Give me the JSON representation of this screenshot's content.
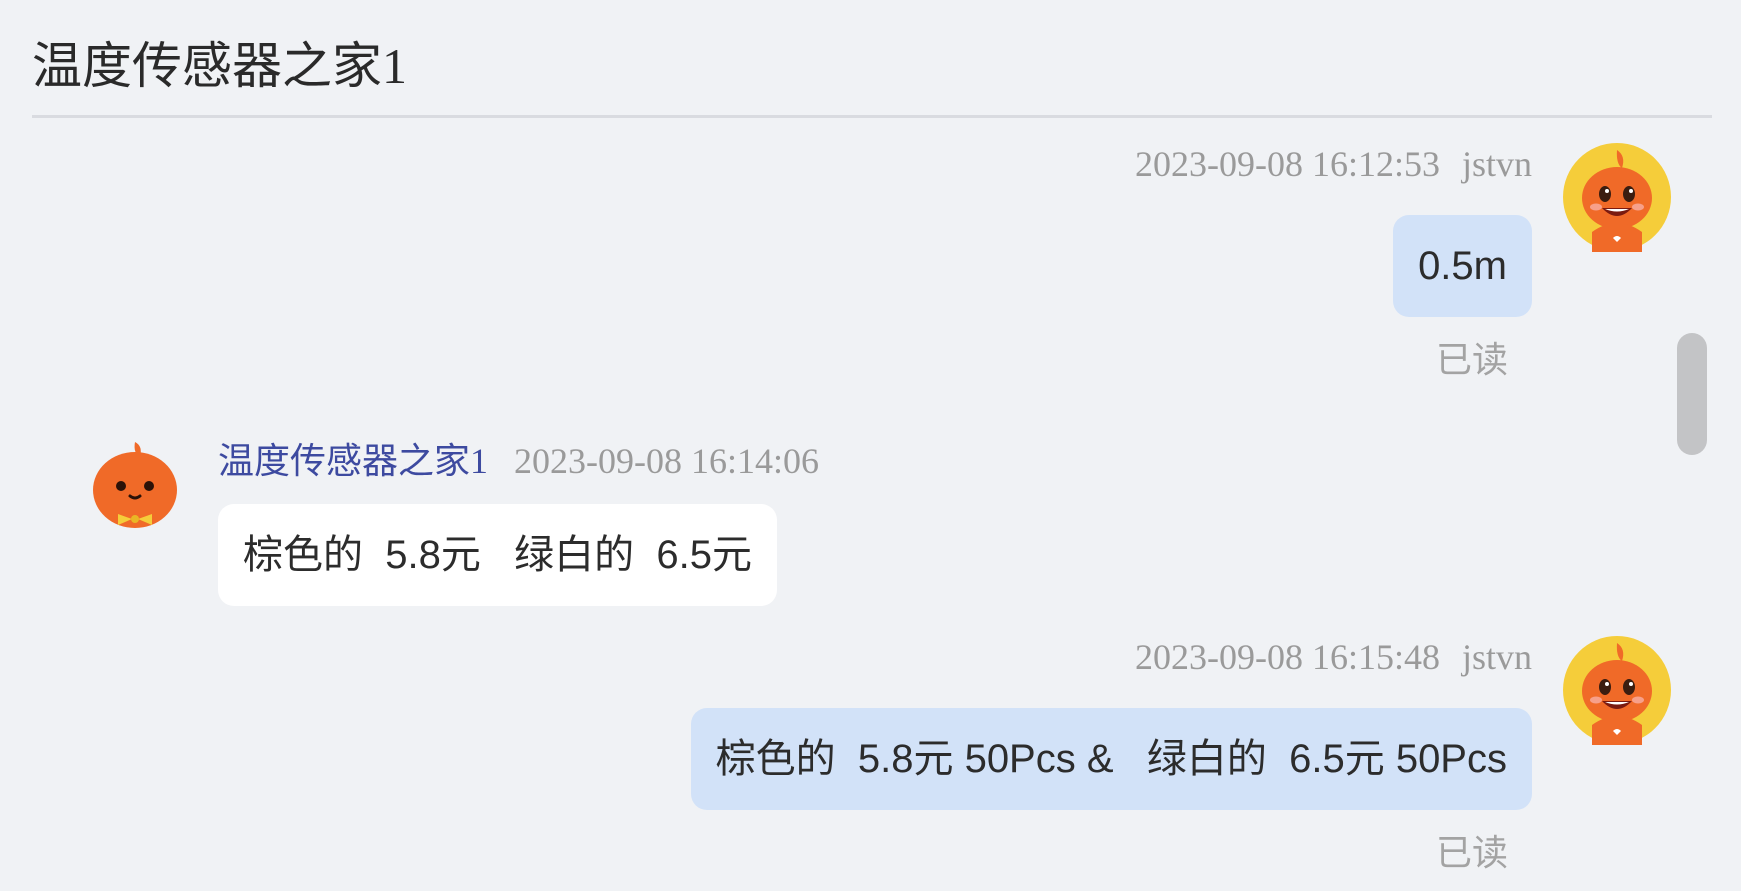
{
  "header": {
    "title": "温度传感器之家1"
  },
  "messages": [
    {
      "direction": "outgoing",
      "timestamp": "2023-09-08 16:12:53",
      "sender": "jstvn",
      "text": "0.5m",
      "status": "已读",
      "avatar_icon": "orange-mascot-avatar-icon"
    },
    {
      "direction": "incoming",
      "sender": "温度传感器之家1",
      "timestamp": "2023-09-08 16:14:06",
      "text": "棕色的  5.8元   绿白的  6.5元",
      "avatar_icon": "orange-pumpkin-bowtie-avatar-icon"
    },
    {
      "direction": "outgoing",
      "timestamp": "2023-09-08 16:15:48",
      "sender": "jstvn",
      "text": "棕色的  5.8元 50Pcs &   绿白的  6.5元 50Pcs",
      "status": "已读",
      "avatar_icon": "orange-mascot-avatar-icon"
    }
  ],
  "colors": {
    "background": "#f0f2f5",
    "outgoing_bubble": "#d2e2f8",
    "incoming_bubble": "#ffffff",
    "sender_name": "#3d4aa0",
    "meta_text": "#9a9a9a",
    "avatar_ring": "#f5cd3a",
    "avatar_orange": "#f06a28"
  }
}
